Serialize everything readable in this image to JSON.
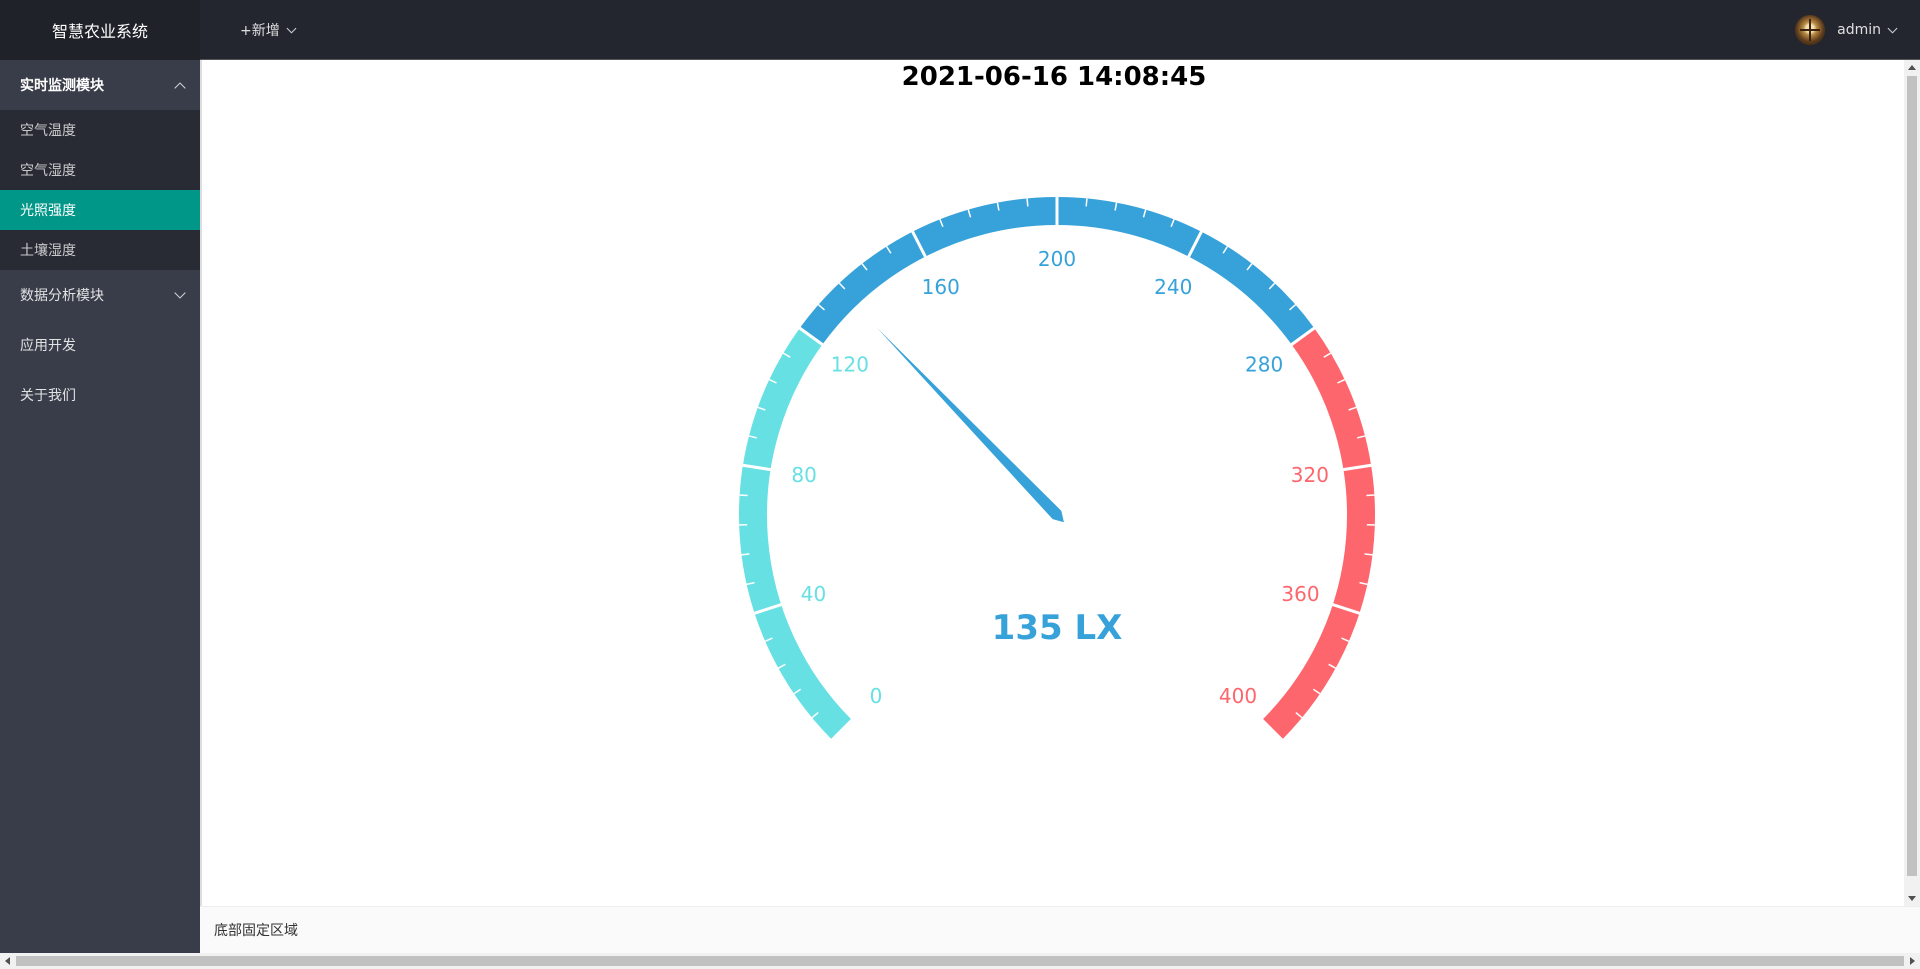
{
  "app_title": "智慧农业系统",
  "header": {
    "add_label": "+新增",
    "username": "admin"
  },
  "sidebar": {
    "groups": [
      {
        "label": "实时监测模块",
        "expanded": true,
        "items": [
          {
            "label": "空气温度",
            "active": false
          },
          {
            "label": "空气湿度",
            "active": false
          },
          {
            "label": "光照强度",
            "active": true
          },
          {
            "label": "土壤湿度",
            "active": false
          }
        ]
      },
      {
        "label": "数据分析模块",
        "expanded": false
      },
      {
        "label": "应用开发"
      },
      {
        "label": "关于我们"
      }
    ]
  },
  "main": {
    "datetime": "2021-06-16 14:08:45"
  },
  "footer": {
    "text": "底部固定区域"
  },
  "colors": {
    "sidebar_bg": "#393d49",
    "header_bg": "#23262e",
    "active": "#009688",
    "gauge_low": "#67e0e3",
    "gauge_mid": "#37a2da",
    "gauge_high": "#fd666d"
  },
  "chart_data": {
    "type": "gauge",
    "min": 0,
    "max": 400,
    "value": 135,
    "unit": "LX",
    "detail_text": "135 LX",
    "tick_labels": [
      "0",
      "40",
      "80",
      "120",
      "160",
      "200",
      "240",
      "280",
      "320",
      "360",
      "400"
    ],
    "bands": [
      {
        "to": 120,
        "color": "#67e0e3"
      },
      {
        "to": 280,
        "color": "#37a2da"
      },
      {
        "to": 400,
        "color": "#fd666d"
      }
    ]
  }
}
